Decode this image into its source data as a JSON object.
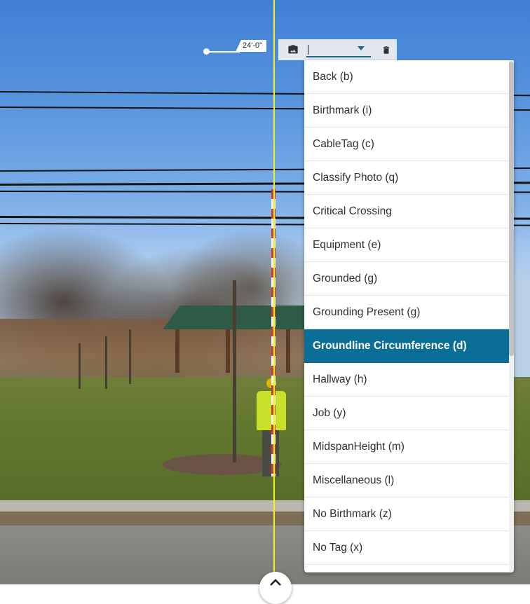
{
  "measurement": {
    "label": "24'-0\""
  },
  "toolbar": {
    "input_value": "",
    "icons": {
      "photo": "photo-library-icon",
      "dropdown": "arrow-drop-down-icon",
      "delete": "trash-icon"
    }
  },
  "dropdown": {
    "items": [
      {
        "label": "Back (b)"
      },
      {
        "label": "Birthmark (i)"
      },
      {
        "label": "CableTag (c)"
      },
      {
        "label": "Classify Photo (q)"
      },
      {
        "label": "Critical Crossing"
      },
      {
        "label": "Equipment (e)"
      },
      {
        "label": "Grounded (g)"
      },
      {
        "label": "Grounding Present (g)"
      },
      {
        "label": "Groundline Circumference (d)",
        "selected": true
      },
      {
        "label": "Hallway (h)"
      },
      {
        "label": "Job (y)"
      },
      {
        "label": "MidspanHeight (m)"
      },
      {
        "label": "Miscellaneous (l)"
      },
      {
        "label": "No Birthmark (z)"
      },
      {
        "label": "No Tag (x)"
      }
    ]
  },
  "colors": {
    "accent": "#0a6e97",
    "plumb_line": "#f4f01c",
    "toolbar_bg": "#e3e8ee"
  },
  "bottom_button": {
    "icon": "chevron-up-icon"
  }
}
